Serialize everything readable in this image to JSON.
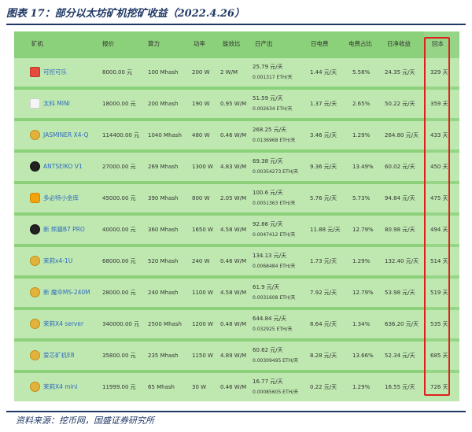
{
  "caption": "图表 17：部分以太坊矿机挖矿收益（2022.4.26）",
  "source": "资料来源：挖币网，国盛证券研究所",
  "table": {
    "headers": [
      "矿机",
      "报价",
      "算力",
      "功率",
      "能效比",
      "日产出",
      "日电费",
      "电费占比",
      "日净收益",
      "回本"
    ],
    "rows": [
      {
        "name": "可挖可乐",
        "logo": "logo-icon",
        "price": "8000.00 元",
        "hash": "100 Mhash",
        "power": "200 W",
        "eff": "2 W/M",
        "out1": "25.79 元/天",
        "out2": "0.001317 ETH/天",
        "elec": "1.44 元/天",
        "ratio": "5.58%",
        "net": "24.35 元/天",
        "payback": "329 天"
      },
      {
        "name": "太科 MINI",
        "logo": "logo-icon",
        "price": "18000.00 元",
        "hash": "200 Mhash",
        "power": "190 W",
        "eff": "0.95 W/M",
        "out1": "51.59 元/天",
        "out2": "0.002634 ETH/天",
        "elec": "1.37 元/天",
        "ratio": "2.65%",
        "net": "50.22 元/天",
        "payback": "359 天"
      },
      {
        "name": "JASMINER X4-Q",
        "logo": "logo-icon",
        "price": "114400.00 元",
        "hash": "1040 Mhash",
        "power": "480 W",
        "eff": "0.46 W/M",
        "out1": "268.25 元/天",
        "out2": "0.0136968 ETH/天",
        "elec": "3.46 元/天",
        "ratio": "1.29%",
        "net": "264.80 元/天",
        "payback": "433 天"
      },
      {
        "name": "ANTSEIKO V1",
        "logo": "logo-icon",
        "price": "27000.00 元",
        "hash": "269 Mhash",
        "power": "1300 W",
        "eff": "4.83 W/M",
        "out1": "69.38 元/天",
        "out2": "0.00354273 ETH/天",
        "elec": "9.36 元/天",
        "ratio": "13.49%",
        "net": "60.02 元/天",
        "payback": "450 天"
      },
      {
        "name": "多必特小金库",
        "logo": "logo-icon",
        "price": "45000.00 元",
        "hash": "390 Mhash",
        "power": "800 W",
        "eff": "2.05 W/M",
        "out1": "100.6 元/天",
        "out2": "0.0051363 ETH/天",
        "elec": "5.76 元/天",
        "ratio": "5.73%",
        "net": "94.84 元/天",
        "payback": "475 天"
      },
      {
        "name": "新  熊猫B7 PRO",
        "logo": "logo-icon",
        "price": "40000.00 元",
        "hash": "360 Mhash",
        "power": "1650 W",
        "eff": "4.58 W/M",
        "out1": "92.86 元/天",
        "out2": "0.0047412 ETH/天",
        "elec": "11.88 元/天",
        "ratio": "12.79%",
        "net": "80.98 元/天",
        "payback": "494 天"
      },
      {
        "name": "茉莉x4-1U",
        "logo": "logo-icon",
        "price": "68000.00 元",
        "hash": "520 Mhash",
        "power": "240 W",
        "eff": "0.46 W/M",
        "out1": "134.13 元/天",
        "out2": "0.0068484 ETH/天",
        "elec": "1.73 元/天",
        "ratio": "1.29%",
        "net": "132.40 元/天",
        "payback": "514 天"
      },
      {
        "name": "新  魔伞MS-240M",
        "logo": "logo-icon",
        "price": "28000.00 元",
        "hash": "240 Mhash",
        "power": "1100 W",
        "eff": "4.58 W/M",
        "out1": "61.9 元/天",
        "out2": "0.0031608 ETH/天",
        "elec": "7.92 元/天",
        "ratio": "12.79%",
        "net": "53.98 元/天",
        "payback": "519 天"
      },
      {
        "name": "茉莉X4 server",
        "logo": "logo-icon",
        "price": "340000.00 元",
        "hash": "2500 Mhash",
        "power": "1200 W",
        "eff": "0.48 W/M",
        "out1": "644.84 元/天",
        "out2": "0.032925 ETH/天",
        "elec": "8.64 元/天",
        "ratio": "1.34%",
        "net": "636.20 元/天",
        "payback": "535 天"
      },
      {
        "name": "爱芯矿机E8",
        "logo": "logo-icon",
        "price": "35800.00 元",
        "hash": "235 Mhash",
        "power": "1150 W",
        "eff": "4.89 W/M",
        "out1": "60.62 元/天",
        "out2": "0.00309495 ETH/天",
        "elec": "8.28 元/天",
        "ratio": "13.66%",
        "net": "52.34 元/天",
        "payback": "685 天"
      },
      {
        "name": "茉莉X4 mini",
        "logo": "logo-icon",
        "price": "11999.00 元",
        "hash": "65 Mhash",
        "power": "30 W",
        "eff": "0.46 W/M",
        "out1": "16.77 元/天",
        "out2": "0.00085605 ETH/天",
        "elec": "0.22 元/天",
        "ratio": "1.29%",
        "net": "16.55 元/天",
        "payback": "726 天"
      }
    ]
  },
  "highlight_color": "#e0201b"
}
